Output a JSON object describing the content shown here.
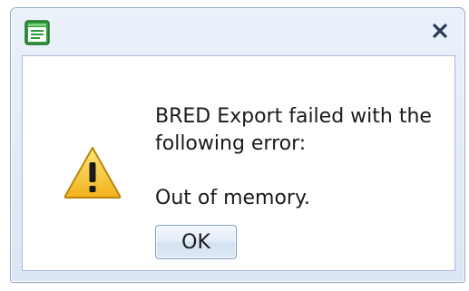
{
  "dialog": {
    "message_line1": "BRED Export failed with the",
    "message_line2": "following error:",
    "error_text": "Out of memory.",
    "ok_label": "OK"
  },
  "titlebar": {
    "close_symbol": "✕",
    "close_icon": "close-icon",
    "app_icon": "window-form-icon"
  },
  "icons": {
    "warning": "warning-icon"
  },
  "colors": {
    "titlebar": "#dbe6f4",
    "border": "#8ea4c1",
    "warning_fill": "#f7c62f",
    "app_icon_green": "#2e9a3a"
  }
}
